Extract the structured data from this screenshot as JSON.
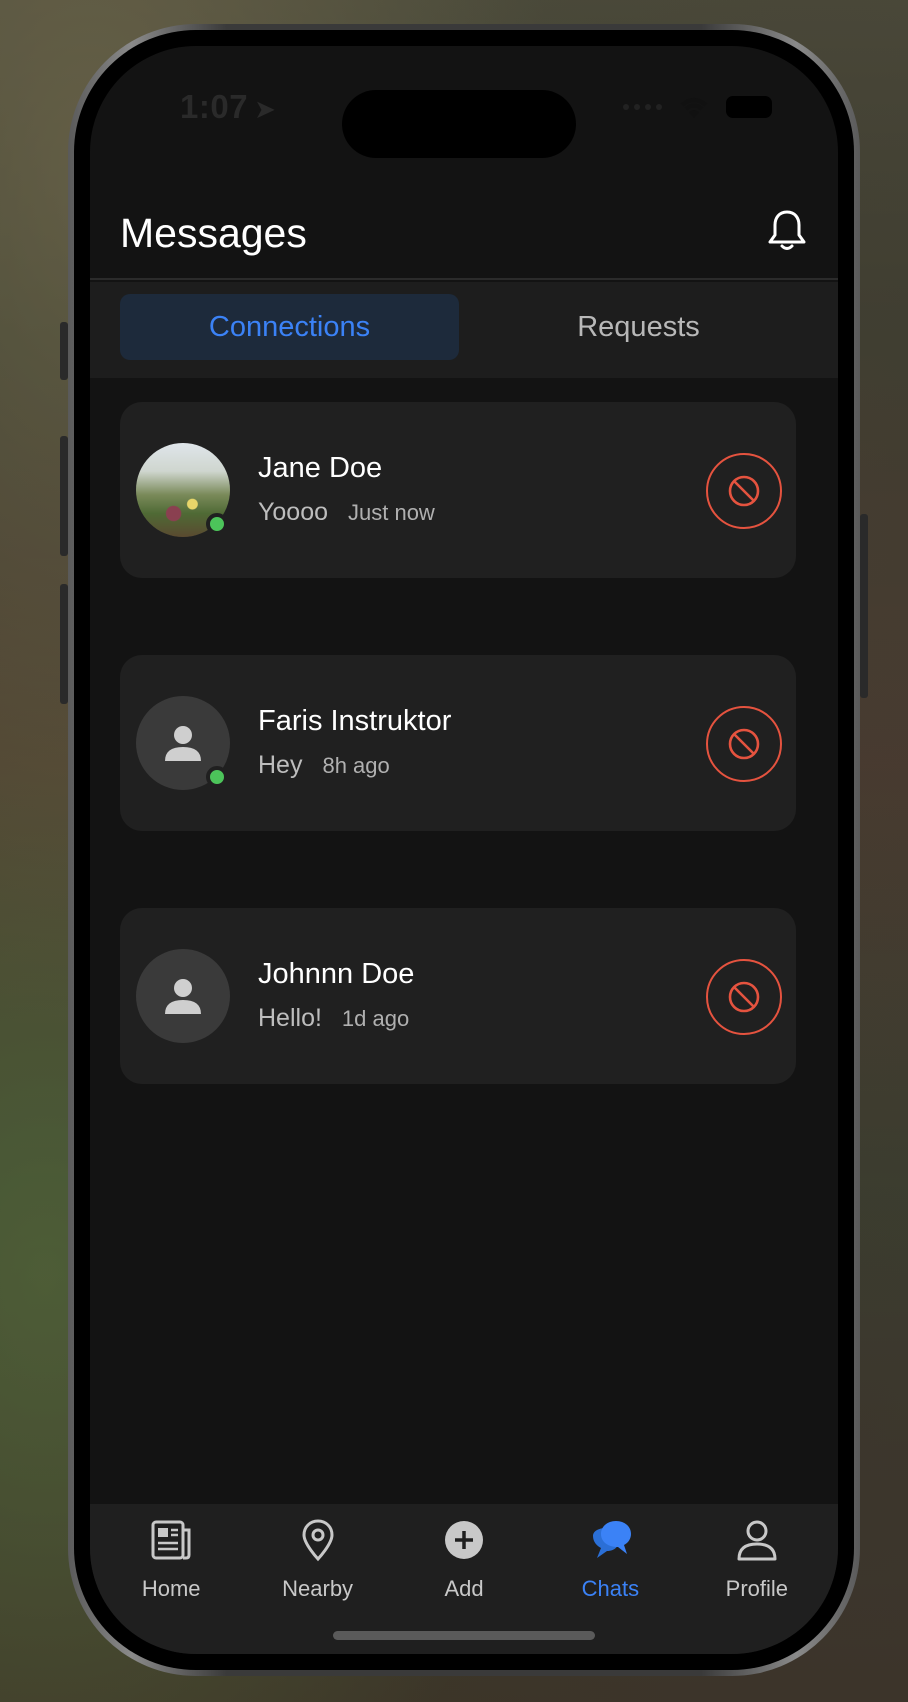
{
  "status": {
    "time": "1:07"
  },
  "header": {
    "title": "Messages"
  },
  "tabs": [
    {
      "label": "Connections",
      "active": true
    },
    {
      "label": "Requests",
      "active": false
    }
  ],
  "conversations": [
    {
      "name": "Jane Doe",
      "message": "Yoooo",
      "time": "Just now",
      "online": true,
      "avatar": "photo"
    },
    {
      "name": "Faris Instruktor",
      "message": "Hey",
      "time": "8h ago",
      "online": true,
      "avatar": "person-icon"
    },
    {
      "name": "Johnnn Doe",
      "message": "Hello!",
      "time": "1d ago",
      "online": false,
      "avatar": "person-icon"
    }
  ],
  "nav": [
    {
      "label": "Home",
      "icon": "newspaper-icon",
      "active": false
    },
    {
      "label": "Nearby",
      "icon": "map-pin-icon",
      "active": false
    },
    {
      "label": "Add",
      "icon": "plus-circle-icon",
      "active": false
    },
    {
      "label": "Chats",
      "icon": "chat-bubbles-icon",
      "active": true
    },
    {
      "label": "Profile",
      "icon": "user-icon",
      "active": false
    }
  ],
  "colors": {
    "accent": "#3b82f6",
    "block": "#e5533f",
    "online": "#4cc45a",
    "background": "#131313",
    "card": "#202020"
  }
}
